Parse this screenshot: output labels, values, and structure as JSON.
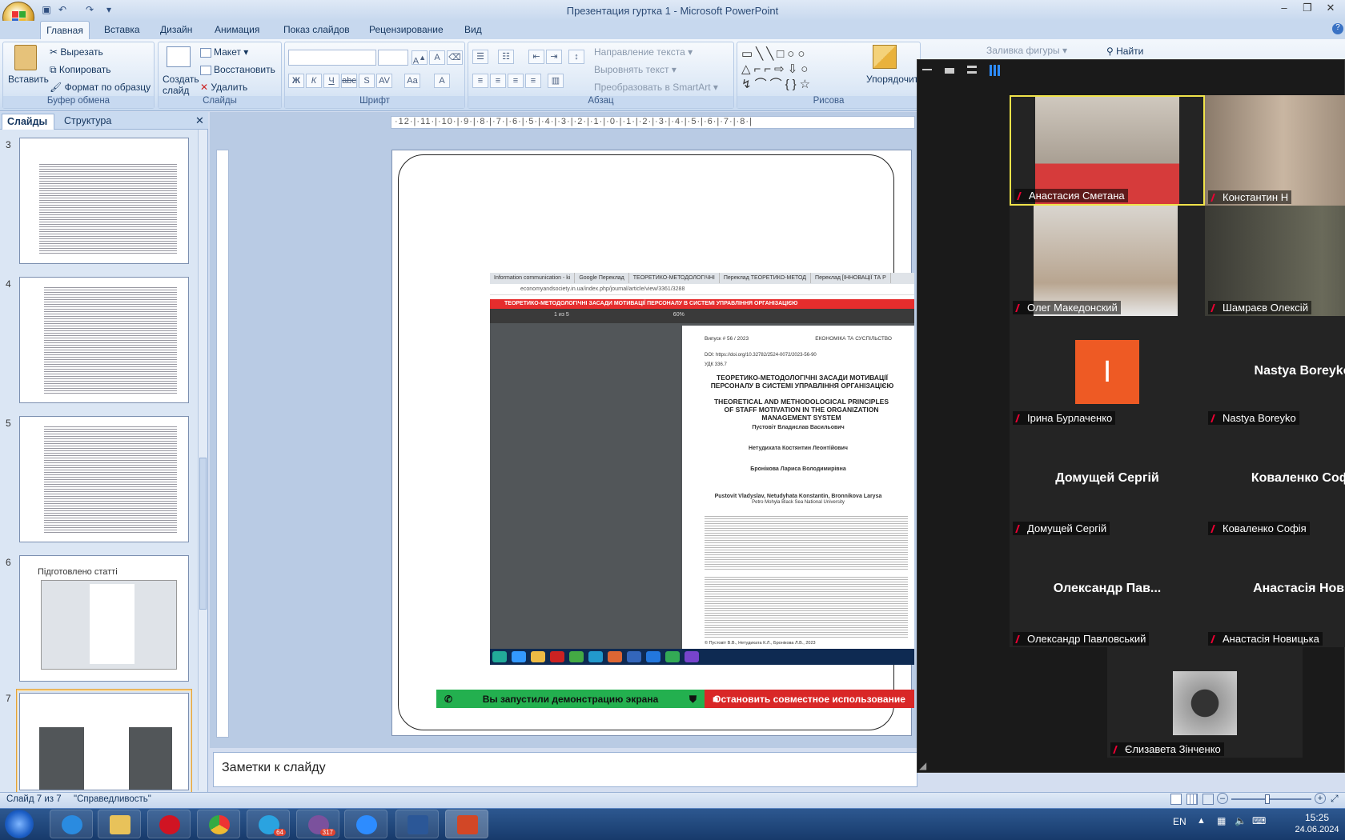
{
  "window": {
    "title": "Презентация гуртка 1  -  Microsoft PowerPoint"
  },
  "ribbon_tabs": [
    "Главная",
    "Вставка",
    "Дизайн",
    "Анимация",
    "Показ слайдов",
    "Рецензирование",
    "Вид"
  ],
  "ribbon": {
    "clipboard": {
      "label": "Буфер обмена",
      "paste": "Вставить",
      "cut": "Вырезать",
      "copy": "Копировать",
      "format": "Формат по образцу"
    },
    "slides": {
      "label": "Слайды",
      "new_slide": "Создать слайд",
      "layout": "Макет",
      "reset": "Восстановить",
      "delete": "Удалить"
    },
    "font": {
      "label": "Шрифт"
    },
    "paragraph": {
      "label": "Абзац",
      "text_dir": "Направление текста",
      "align_text": "Выровнять текст",
      "smartart": "Преобразовать в SmartArt"
    },
    "drawing": {
      "label": "Рисова",
      "arrange": "Упорядочить",
      "fill": "Заливка фигуры"
    },
    "editing": {
      "find": "Найти"
    }
  },
  "panel_tabs": {
    "slides": "Слайды",
    "outline": "Структура"
  },
  "thumbnails": [
    {
      "num": "3"
    },
    {
      "num": "4"
    },
    {
      "num": "5"
    },
    {
      "num": "6",
      "title": "Підготовлено статті"
    },
    {
      "num": "7"
    }
  ],
  "ruler_text": "·12·|·11·|·10·|·9·|·8·|·7·|·6·|·5·|·4·|·3·|·2·|·1·|·0·|·1·|·2·|·3·|·4·|·5·|·6·|·7·|·8·|",
  "browser": {
    "tabs": [
      "Information communication - ki",
      "Google Переклад",
      "ТЕОРЕТИКО-МЕТОДОЛОГІЧНІ",
      "Переклад ТЕОРЕТИКО-МЕТОД",
      "Переклад [ІННОВАЦІЇ ТА Р"
    ],
    "url": "economyandsociety.in.ua/index.php/journal/article/view/3361/3288",
    "pdf_bar": "ТЕОРЕТИКО-МЕТОДОЛОГІЧНІ ЗАСАДИ МОТИВАЦІЇ ПЕРСОНАЛУ В СИСТЕМІ УПРАВЛІННЯ ОРГАНІЗАЦІЄЮ",
    "pdf_page": "1  из 5",
    "pdf_zoom": "60%"
  },
  "pdf": {
    "issue": "Випуск # 56 / 2023",
    "journal": "ЕКОНОМІКА ТА СУСПІЛЬСТВО",
    "doi": "DOI: https://doi.org/10.32782/2524-0072/2023-56-90",
    "udc": "УДК 336.7",
    "title_ua": "ТЕОРЕТИКО-МЕТОДОЛОГІЧНІ ЗАСАДИ МОТИВАЦІЇ ПЕРСОНАЛУ В СИСТЕМІ УПРАВЛІННЯ ОРГАНІЗАЦІЄЮ",
    "title_en": "THEORETICAL AND METHODOLOGICAL PRINCIPLES OF STAFF MOTIVATION IN THE ORGANIZATION MANAGEMENT SYSTEM",
    "author1": "Пустовіт Владислав Васильович",
    "author2": "Нетудихата Костянтин Леонтійович",
    "author3": "Бронікова Лариса Володимирівна",
    "authors_en": "Pustovit Vladyslav, Netudyhata Konstantin, Bronnikova Larysa",
    "university_en": "Petro Mohyla Black Sea National University",
    "footer": "© Пустовіт В.В., Нетудихата К.Л., Бронікова Л.В., 2023"
  },
  "share": {
    "started": "Вы запустили демонстрацию экрана",
    "stop": "Остановить совместное использование"
  },
  "notes": {
    "placeholder": "Заметки к слайду"
  },
  "status": {
    "slide": "Слайд 7 из 7",
    "theme": "\"Справедливость\""
  },
  "tray": {
    "lang": "EN",
    "time": "15:25",
    "date": "24.06.2024"
  },
  "taskbar": {
    "telegram_badge": "64",
    "viber_badge": "317"
  },
  "zoom": {
    "participants": [
      {
        "name": "Анастасия Сметана",
        "video": true
      },
      {
        "name": "Константин Н",
        "video": true
      },
      {
        "name": "Олег Македонский",
        "video": true
      },
      {
        "name": "Шамраєв Олексій",
        "video": true
      },
      {
        "name": "Ірина Бурлаченко",
        "initial": "І"
      },
      {
        "name": "Nastya Boreyko",
        "big": "Nastya Boreyko"
      },
      {
        "name": "Домущей Сергій",
        "big": "Домущей Сергій"
      },
      {
        "name": "Коваленко Софія",
        "big": "Коваленко Софі"
      },
      {
        "name": "Олександр Павловський",
        "big": "Олександр  Пав..."
      },
      {
        "name": "Анастасія Новицька",
        "big": "Анастасія Нови"
      },
      {
        "name": "Єлизавета Зінченко",
        "avatar": true
      }
    ]
  },
  "colors": {
    "ribbon_blue": "#dce8f6",
    "zoom_dark": "#1a1a1a",
    "share_green": "#23b04f",
    "share_red": "#d92727",
    "orange_tile": "#ee5a24",
    "speaker_border": "#f0e34a"
  }
}
